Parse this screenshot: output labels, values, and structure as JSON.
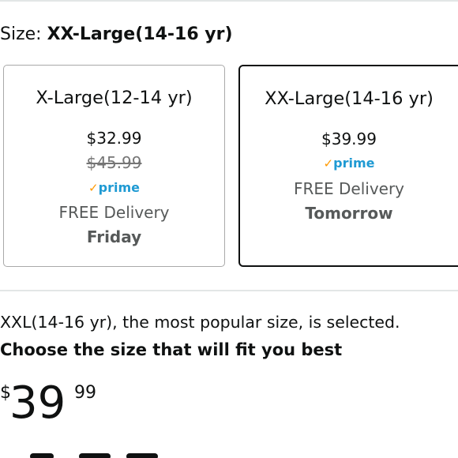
{
  "size_selector": {
    "prefix": "Size: ",
    "selected_value": "XX-Large(14-16 yr)"
  },
  "options": [
    {
      "title": "X-Large(12-14 yr)",
      "price": "$32.99",
      "list_price": "$45.99",
      "prime_check": "✓",
      "prime_word": "prime",
      "delivery": "FREE Delivery",
      "delivery_day": "Friday",
      "selected": false
    },
    {
      "title": "XX-Large(14-16 yr)",
      "price": "$39.99",
      "prime_check": "✓",
      "prime_word": "prime",
      "delivery": "FREE Delivery",
      "delivery_day": "Tomorrow",
      "selected": true
    }
  ],
  "info": {
    "popular_message": "XXL(14-16 yr), the most popular size, is selected.",
    "fit_message": "Choose the size that will fit you best"
  },
  "price_display": {
    "currency": "$",
    "whole": "39",
    "fraction": "99"
  },
  "colors": {
    "prime_check": "#ff9900",
    "prime_word": "#1f9ad3",
    "selected_border": "#0f1111",
    "unselected_border": "#a9a9a9"
  }
}
